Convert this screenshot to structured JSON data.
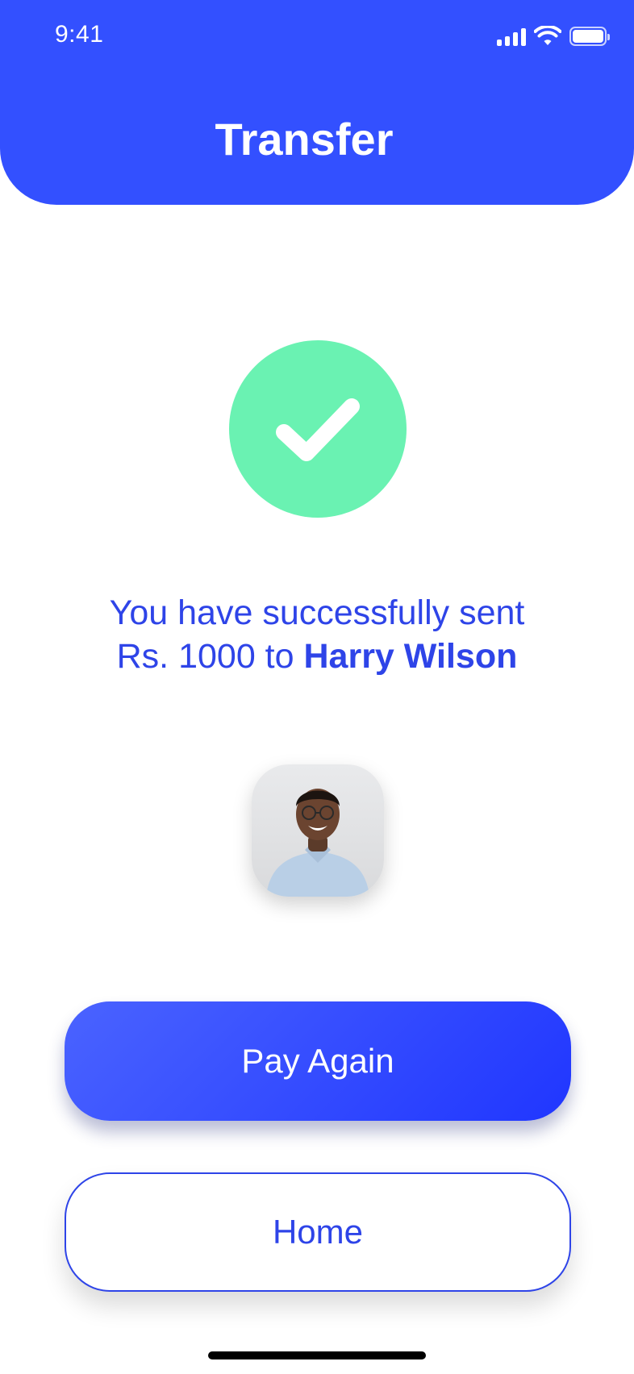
{
  "status_bar": {
    "time": "9:41"
  },
  "header": {
    "title": "Transfer",
    "color": "#3350FF"
  },
  "success": {
    "icon": "check-icon",
    "circle_color": "#6AF2B2",
    "message_prefix": "You have successfully sent Rs. 1000 to ",
    "recipient_name": "Harry Wilson"
  },
  "recipient": {
    "avatar": "avatar"
  },
  "actions": {
    "pay_again_label": "Pay Again",
    "home_label": "Home"
  },
  "colors": {
    "accent": "#2E44E8",
    "primary_button_start": "#4A63FF",
    "primary_button_end": "#2036FF"
  }
}
